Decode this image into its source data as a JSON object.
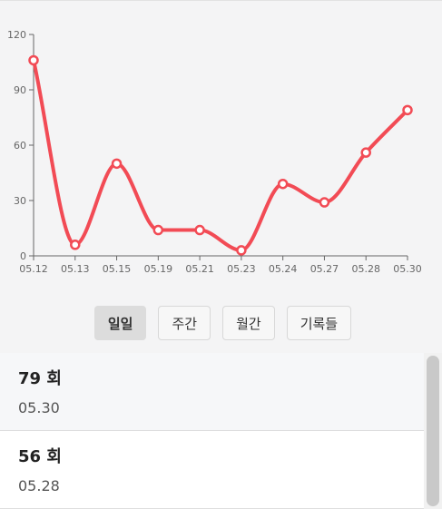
{
  "chart_data": {
    "type": "line",
    "x": [
      "05.12",
      "05.13",
      "05.15",
      "05.19",
      "05.21",
      "05.23",
      "05.24",
      "05.27",
      "05.28",
      "05.30"
    ],
    "series": [
      {
        "values": [
          106,
          6,
          50,
          14,
          14,
          3,
          39,
          29,
          56,
          79
        ],
        "color": "#f24b55"
      }
    ],
    "ylim": [
      0,
      120
    ],
    "yticks": [
      0,
      30,
      60,
      90,
      120
    ],
    "grid": false,
    "title": "",
    "xlabel": "",
    "ylabel": ""
  },
  "tabs": [
    {
      "label": "일일",
      "active": true
    },
    {
      "label": "주간",
      "active": false
    },
    {
      "label": "월간",
      "active": false
    },
    {
      "label": "기록들",
      "active": false
    }
  ],
  "list": [
    {
      "value": "79 회",
      "date": "05.30"
    },
    {
      "value": "56 회",
      "date": "05.28"
    }
  ]
}
